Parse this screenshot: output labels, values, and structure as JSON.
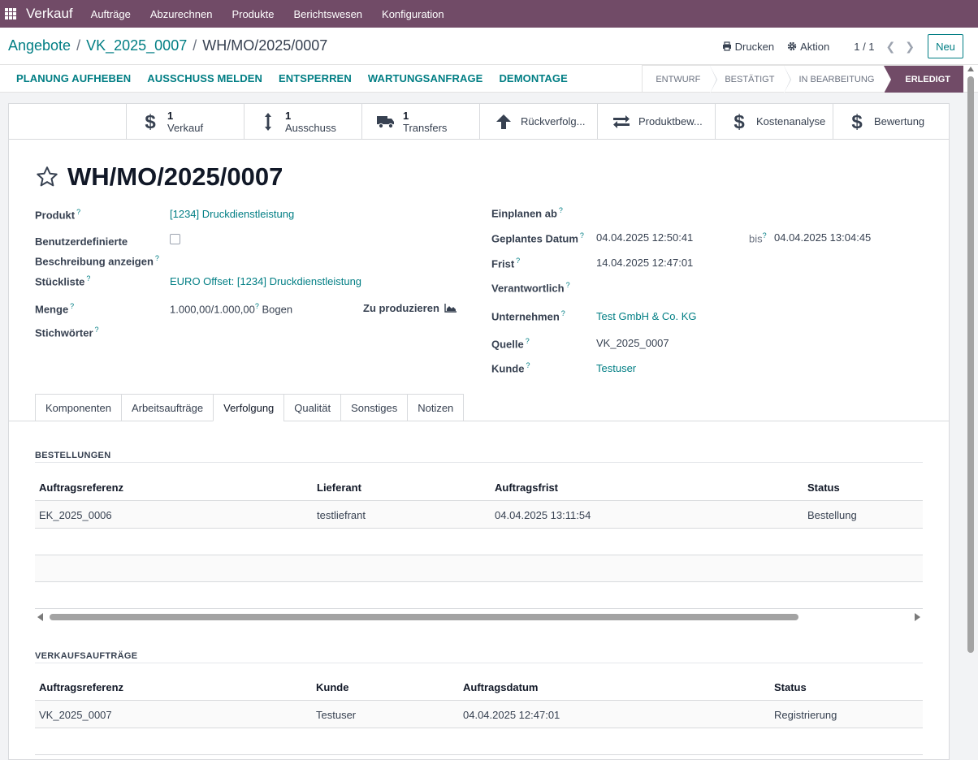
{
  "navbar": {
    "app_name": "Verkauf",
    "menu": [
      "Aufträge",
      "Abzurechnen",
      "Produkte",
      "Berichtswesen",
      "Konfiguration"
    ]
  },
  "breadcrumb": {
    "level1": "Angebote",
    "level2": "VK_2025_0007",
    "current": "WH/MO/2025/0007"
  },
  "control": {
    "print_label": "Drucken",
    "action_label": "Aktion",
    "pager": "1 / 1",
    "new_label": "Neu"
  },
  "statusbar": {
    "buttons": [
      "PLANUNG AUFHEBEN",
      "AUSSCHUSS MELDEN",
      "ENTSPERREN",
      "WARTUNGSANFRAGE",
      "DEMONTAGE"
    ],
    "stages": [
      "ENTWURF",
      "BESTÄTIGT",
      "IN BEARBEITUNG",
      "ERLEDIGT"
    ],
    "active_stage": "ERLEDIGT"
  },
  "smart_buttons": {
    "sale": {
      "value": "1",
      "label": "Verkauf"
    },
    "scrap": {
      "value": "1",
      "label": "Ausschuss"
    },
    "transfers": {
      "value": "1",
      "label": "Transfers"
    },
    "traceability": "Rückverfolg...",
    "product_moves": "Produktbew...",
    "cost_analysis": "Kostenanalyse",
    "valuation": "Bewertung"
  },
  "record": {
    "title": "WH/MO/2025/0007"
  },
  "fields_left": {
    "product_label": "Produkt",
    "product_value": "[1234] Druckdienstleistung",
    "custom_desc_label_1": "Benutzerdefinierte",
    "custom_desc_label_2": "Beschreibung anzeigen",
    "bom_label": "Stückliste",
    "bom_value": "EURO Offset: [1234] Druckdienstleistung",
    "qty_label": "Menge",
    "qty_value": "1.000,00/1.000,00",
    "qty_unit": "Bogen",
    "to_produce_label": "Zu produzieren",
    "tags_label": "Stichwörter",
    "help_mark": "?"
  },
  "fields_right": {
    "schedule_label": "Einplanen ab",
    "planned_label": "Geplantes Datum",
    "planned_from": "04.04.2025 12:50:41",
    "until_label": "bis",
    "planned_to": "04.04.2025 13:04:45",
    "deadline_label": "Frist",
    "deadline_value": "14.04.2025 12:47:01",
    "responsible_label": "Verantwortlich",
    "company_label": "Unternehmen",
    "company_value": "Test GmbH & Co. KG",
    "source_label": "Quelle",
    "source_value": "VK_2025_0007",
    "customer_label": "Kunde",
    "customer_value": "Testuser"
  },
  "tabs": [
    "Komponenten",
    "Arbeitsaufträge",
    "Verfolgung",
    "Qualität",
    "Sonstiges",
    "Notizen"
  ],
  "active_tab": "Verfolgung",
  "purchase_orders": {
    "title": "BESTELLUNGEN",
    "headers": [
      "Auftragsreferenz",
      "Lieferant",
      "Auftragsfrist",
      "Status"
    ],
    "rows": [
      [
        "EK_2025_0006",
        "testliefrant",
        "04.04.2025 13:11:54",
        "Bestellung"
      ]
    ]
  },
  "sale_orders": {
    "title": "VERKAUFSAUFTRÄGE",
    "headers": [
      "Auftragsreferenz",
      "Kunde",
      "Auftragsdatum",
      "Status"
    ],
    "rows": [
      [
        "VK_2025_0007",
        "Testuser",
        "04.04.2025 12:47:01",
        "Registrierung"
      ]
    ]
  },
  "colors": {
    "brand": "#714b67",
    "link": "#017e84"
  }
}
